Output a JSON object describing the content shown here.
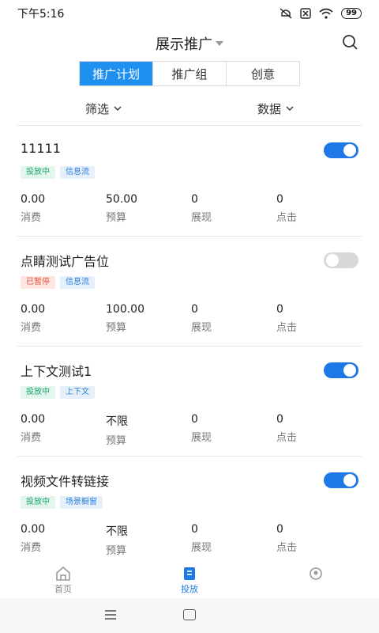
{
  "status": {
    "time": "下午5:16",
    "battery": "99"
  },
  "header": {
    "title": "展示推广"
  },
  "tabs": [
    "推广计划",
    "推广组",
    "创意"
  ],
  "filters": {
    "filter_label": "筛选",
    "data_label": "数据"
  },
  "metric_labels": [
    "消费",
    "预算",
    "展现",
    "点击"
  ],
  "campaigns": [
    {
      "name": "11111",
      "enabled": true,
      "tags": [
        {
          "text": "投放中",
          "color": "green"
        },
        {
          "text": "信息流",
          "color": "blue"
        }
      ],
      "values": [
        "0.00",
        "50.00",
        "0",
        "0"
      ]
    },
    {
      "name": "点睛测试广告位",
      "enabled": false,
      "tags": [
        {
          "text": "已暂停",
          "color": "red"
        },
        {
          "text": "信息流",
          "color": "blue"
        }
      ],
      "values": [
        "0.00",
        "100.00",
        "0",
        "0"
      ]
    },
    {
      "name": "上下文测试1",
      "enabled": true,
      "tags": [
        {
          "text": "投放中",
          "color": "green"
        },
        {
          "text": "上下文",
          "color": "blue"
        }
      ],
      "values": [
        "0.00",
        "不限",
        "0",
        "0"
      ]
    },
    {
      "name": "视频文件转链接",
      "enabled": true,
      "tags": [
        {
          "text": "投放中",
          "color": "green"
        },
        {
          "text": "场景橱窗",
          "color": "blue"
        }
      ],
      "values": [
        "0.00",
        "不限",
        "0",
        "0"
      ]
    }
  ],
  "tabbar": {
    "home_label": "首页",
    "delivery_label": "投放"
  },
  "colors": {
    "accent": "#1f8ff0",
    "toggle_on": "#1f78e8",
    "toggle_off": "#d8d8d8"
  }
}
